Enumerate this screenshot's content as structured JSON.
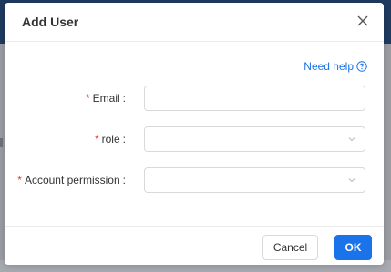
{
  "modal": {
    "title": "Add User",
    "help_link": "Need help"
  },
  "form": {
    "email": {
      "label": "Email",
      "required": "*",
      "separator": ":",
      "value": ""
    },
    "role": {
      "label": "role",
      "required": "*",
      "separator": ":",
      "selected": ""
    },
    "account_permission": {
      "label": "Account permission",
      "required": "*",
      "separator": ":",
      "selected": ""
    }
  },
  "footer": {
    "cancel_label": "Cancel",
    "ok_label": "OK"
  },
  "icons": {
    "close": "close-icon",
    "help": "help-icon",
    "dropdown": "chevron-down-icon"
  },
  "colors": {
    "accent": "#1a73e8",
    "required": "#e53935",
    "overlay": "#8f9298"
  }
}
